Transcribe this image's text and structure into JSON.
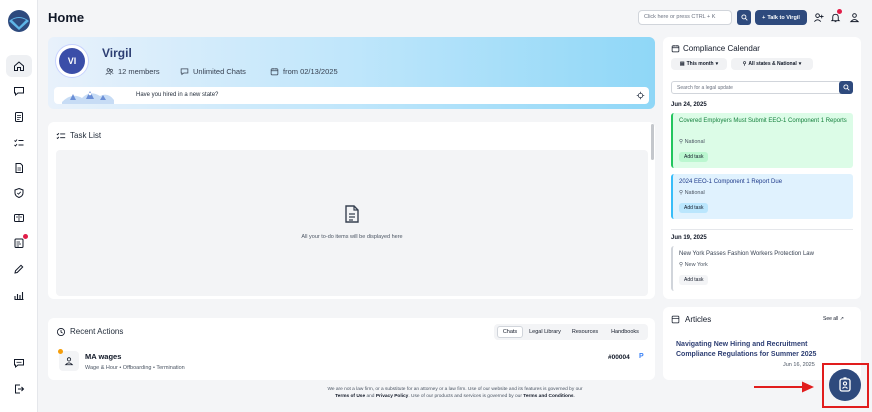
{
  "header": {
    "title": "Home",
    "search_placeholder": "Click here or press CTRL + K",
    "talk_label": "Talk to Virgil"
  },
  "profile": {
    "initials": "VI",
    "name": "Virgil",
    "members": "12 members",
    "chats": "Unlimited Chats",
    "since": "from 02/13/2025",
    "hire_prompt": "Have you hired in a new state?"
  },
  "tasks": {
    "title": "Task List",
    "empty": "All your to-do items will be displayed here"
  },
  "recent": {
    "title": "Recent Actions",
    "tabs": [
      "Chats",
      "Legal Library",
      "Resources",
      "Handbooks"
    ],
    "item": {
      "title": "MA wages",
      "tags": "Wage & Hour  •  Offboarding  •  Termination",
      "id": "#00004",
      "flag": "P"
    }
  },
  "footer": {
    "line1": "We are not a law firm, or a substitute for an attorney or a law firm. Use of our website and its features is governed by our",
    "terms": "Terms of Use",
    "and": " and ",
    "privacy": "Privacy Policy",
    "line2": ". Use of our products and services is governed by our ",
    "terms_conditions": "Terms and Conditions",
    "end": "."
  },
  "calendar": {
    "title": "Compliance Calendar",
    "filter_month": "This month",
    "filter_states": "All states & National",
    "search_placeholder": "Search for a legal update",
    "groups": [
      {
        "date": "Jun 24, 2025",
        "events": [
          {
            "title": "Covered Employers Must Submit EEO-1 Component 1 Reports",
            "location": "National",
            "action": "Add task"
          },
          {
            "title": "2024 EEO-1 Component 1 Report Due",
            "location": "National",
            "action": "Add task"
          }
        ]
      },
      {
        "date": "Jun 19, 2025",
        "events": [
          {
            "title": "New York Passes Fashion Workers Protection Law",
            "location": "New York",
            "action": "Add task"
          }
        ]
      }
    ]
  },
  "articles": {
    "title": "Articles",
    "see_all": "See all",
    "item_title": "Navigating New Hiring and Recruitment Compliance Regulations for Summer 2025",
    "item_date": "Jun 16, 2025"
  },
  "colors": {
    "primary": "#2e4a7d",
    "event_green": "#22c55e",
    "event_blue": "#38bdf8",
    "annotation_red": "#e11d1d"
  }
}
